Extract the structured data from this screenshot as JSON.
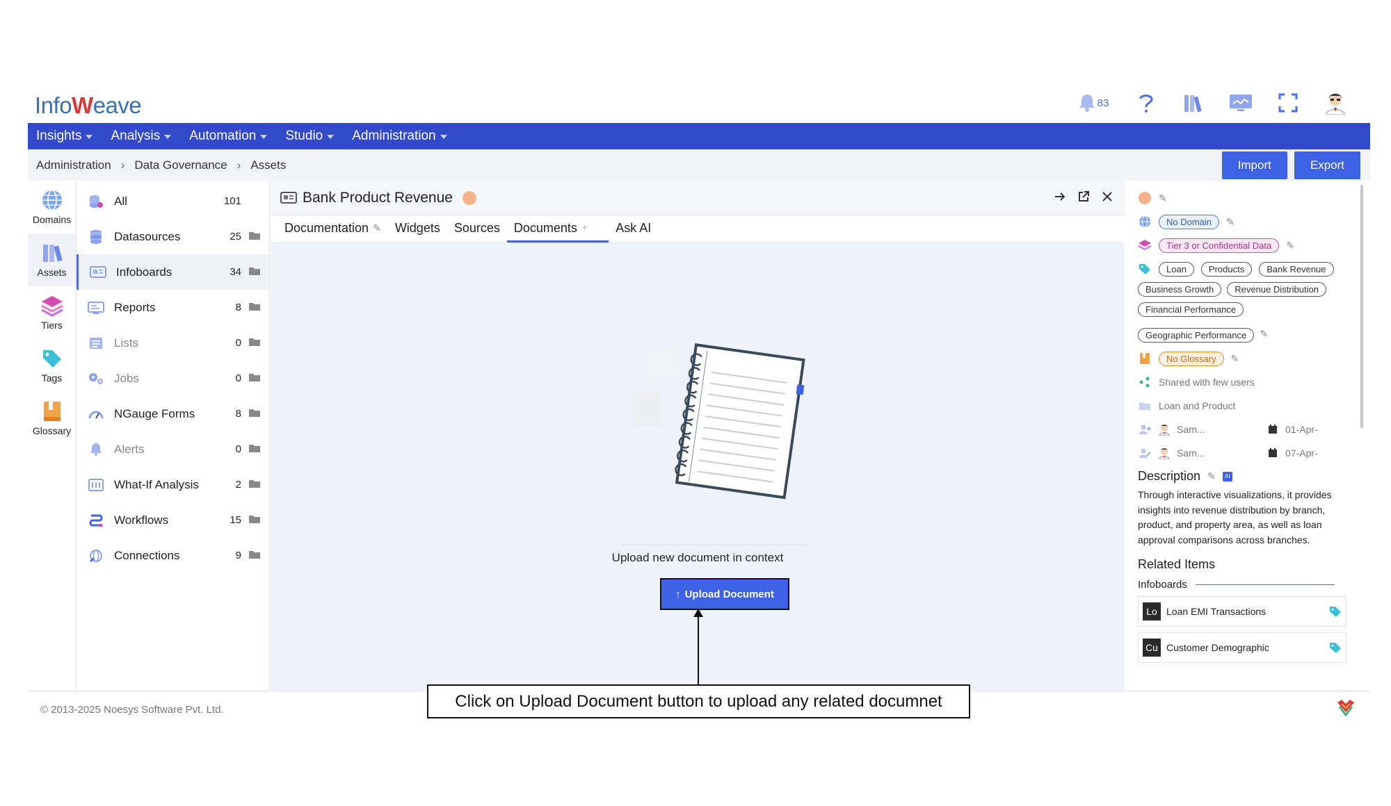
{
  "brand": {
    "logo_left": "Info",
    "logo_mid": "W",
    "logo_right": "eave"
  },
  "header": {
    "notification_count": "83"
  },
  "menu": [
    {
      "label": "Insights"
    },
    {
      "label": "Analysis"
    },
    {
      "label": "Automation"
    },
    {
      "label": "Studio"
    },
    {
      "label": "Administration"
    }
  ],
  "breadcrumb": [
    "Administration",
    "Data Governance",
    "Assets"
  ],
  "actions": {
    "import_label": "Import",
    "export_label": "Export"
  },
  "rail": [
    {
      "label": "Domains",
      "icon": "globe-icon"
    },
    {
      "label": "Assets",
      "icon": "books-icon"
    },
    {
      "label": "Tiers",
      "icon": "layers-icon"
    },
    {
      "label": "Tags",
      "icon": "tag-icon"
    },
    {
      "label": "Glossary",
      "icon": "glossary-icon"
    }
  ],
  "assets": [
    {
      "label": "All",
      "count": "101"
    },
    {
      "label": "Datasources",
      "count": "25"
    },
    {
      "label": "Infoboards",
      "count": "34"
    },
    {
      "label": "Reports",
      "count": "8"
    },
    {
      "label": "Lists",
      "count": "0"
    },
    {
      "label": "Jobs",
      "count": "0"
    },
    {
      "label": "NGauge Forms",
      "count": "8"
    },
    {
      "label": "Alerts",
      "count": "0"
    },
    {
      "label": "What-If Analysis",
      "count": "2"
    },
    {
      "label": "Workflows",
      "count": "15"
    },
    {
      "label": "Connections",
      "count": "9"
    }
  ],
  "center": {
    "title": "Bank Product Revenue",
    "tabs": [
      "Documentation",
      "Widgets",
      "Sources",
      "Documents",
      "Ask AI"
    ],
    "empty_text": "Upload new document in context",
    "upload_label": "Upload Document"
  },
  "details": {
    "domain": "No Domain",
    "tier": "Tier 3 or Confidential Data",
    "tags": [
      "Loan",
      "Products",
      "Bank Revenue",
      "Business Growth",
      "Revenue Distribution",
      "Financial Performance",
      "Geographic Performance"
    ],
    "glossary": "No Glossary",
    "shared": "Shared with few users",
    "folder": "Loan and Product",
    "created_by": "Sam...",
    "created_on": "01-Apr-",
    "modified_by": "Sam...",
    "modified_on": "07-Apr-",
    "description_title": "Description",
    "description": "Through interactive visualizations, it provides insights into revenue distribution by branch, product, and property area, as well as loan approval comparisons across branches.",
    "related_title": "Related Items",
    "related_sub": "Infoboards",
    "related": [
      {
        "badge": "Lo",
        "label": "Loan EMI Transactions"
      },
      {
        "badge": "Cu",
        "label": "Customer Demographic"
      }
    ]
  },
  "footer": {
    "copyright": "© 2013-2025 Noesys Software Pvt. Ltd."
  },
  "annotation": {
    "callout": "Click on Upload Document button to upload any related documnet"
  }
}
